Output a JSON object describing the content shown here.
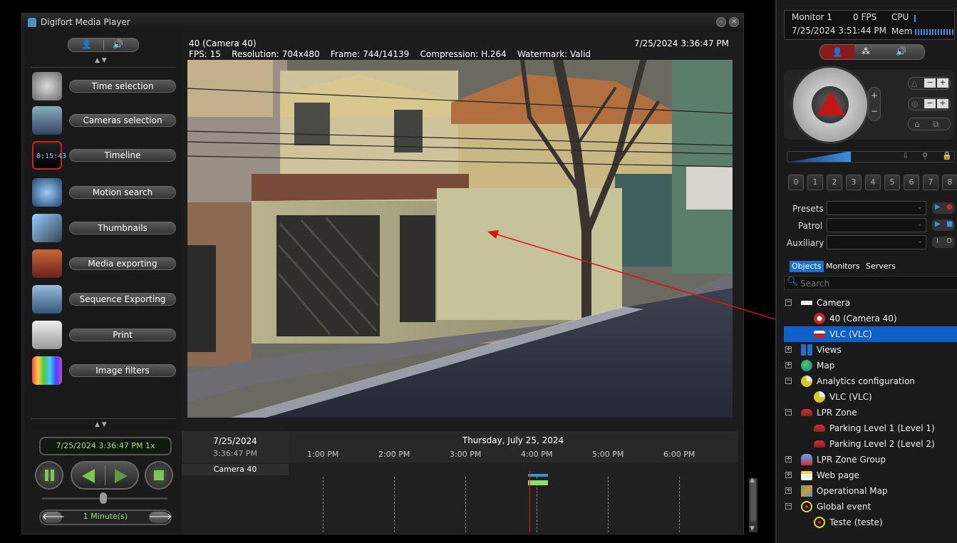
{
  "window": {
    "title": "Digifort Media Player"
  },
  "tools": [
    {
      "label": "Time selection",
      "icon": "stopwatch-icon"
    },
    {
      "label": "Cameras selection",
      "icon": "cameras-icon"
    },
    {
      "label": "Timeline",
      "icon": "clapperboard-icon",
      "clock": "0:15:43"
    },
    {
      "label": "Motion search",
      "icon": "motion-search-icon"
    },
    {
      "label": "Thumbnails",
      "icon": "satellite-icon"
    },
    {
      "label": "Media exporting",
      "icon": "film-icon"
    },
    {
      "label": "Sequence Exporting",
      "icon": "image-stack-icon"
    },
    {
      "label": "Print",
      "icon": "printer-icon"
    },
    {
      "label": "Image filters",
      "icon": "color-bars-icon"
    }
  ],
  "video": {
    "camera_title": "40 (Camera 40)",
    "timestamp": "7/25/2024 3:36:47 PM",
    "fps": "FPS: 15",
    "resolution": "Resolution: 704x480",
    "frame": "Frame: 744/14139",
    "compression": "Compression: H.264",
    "watermark": "Watermark: Valid"
  },
  "playback": {
    "datetime": "7/25/2024 3:36:47 PM 1x",
    "step": "1 Minute(s)"
  },
  "timeline": {
    "date": "7/25/2024",
    "time": "3:36:47 PM",
    "day_label": "Thursday, July 25, 2024",
    "hours": [
      "1:00 PM",
      "2:00 PM",
      "3:00 PM",
      "4:00 PM",
      "5:00 PM",
      "6:00 PM"
    ],
    "track_label": "Camera 40"
  },
  "monitor": {
    "name": "Monitor 1",
    "fps": "0 FPS",
    "cpu_label": "CPU",
    "datetime": "7/25/2024 3:51:44 PM",
    "mem_label": "Mem"
  },
  "ptz": {
    "presets_label": "Presets",
    "patrol_label": "Patrol",
    "auxiliary_label": "Auxiliary",
    "numkeys": [
      "0",
      "1",
      "2",
      "3",
      "4",
      "5",
      "6",
      "7",
      "8"
    ]
  },
  "tabs": [
    "Objects",
    "Monitors",
    "Servers"
  ],
  "search_placeholder": "Search",
  "tree": [
    {
      "label": "Camera",
      "level": 0,
      "exp": "−",
      "icon": "camera-icon"
    },
    {
      "label": "40 (Camera 40)",
      "level": 1,
      "icon": "dome-camera-icon"
    },
    {
      "label": "VLC (VLC)",
      "level": 1,
      "icon": "camera-off-icon",
      "selected": true
    },
    {
      "label": "Views",
      "level": 0,
      "exp": "+",
      "icon": "views-grid-icon"
    },
    {
      "label": "Map",
      "level": 0,
      "exp": "+",
      "icon": "globe-icon"
    },
    {
      "label": "Analytics configuration",
      "level": 0,
      "exp": "−",
      "icon": "pie-chart-icon"
    },
    {
      "label": "VLC (VLC)",
      "level": 1,
      "icon": "pie-chart-icon"
    },
    {
      "label": "LPR Zone",
      "level": 0,
      "exp": "−",
      "icon": "car-icon"
    },
    {
      "label": "Parking Level 1 (Level 1)",
      "level": 1,
      "icon": "car-icon"
    },
    {
      "label": "Parking Level 2 (Level 2)",
      "level": 1,
      "icon": "car-icon"
    },
    {
      "label": "LPR Zone Group",
      "level": 0,
      "exp": "+",
      "icon": "car-group-icon"
    },
    {
      "label": "Web page",
      "level": 0,
      "exp": "+",
      "icon": "web-page-icon"
    },
    {
      "label": "Operational Map",
      "level": 0,
      "exp": "+",
      "icon": "operational-map-icon"
    },
    {
      "label": "Global event",
      "level": 0,
      "exp": "−",
      "icon": "event-icon"
    },
    {
      "label": "Teste (teste)",
      "level": 1,
      "icon": "event-icon"
    }
  ]
}
